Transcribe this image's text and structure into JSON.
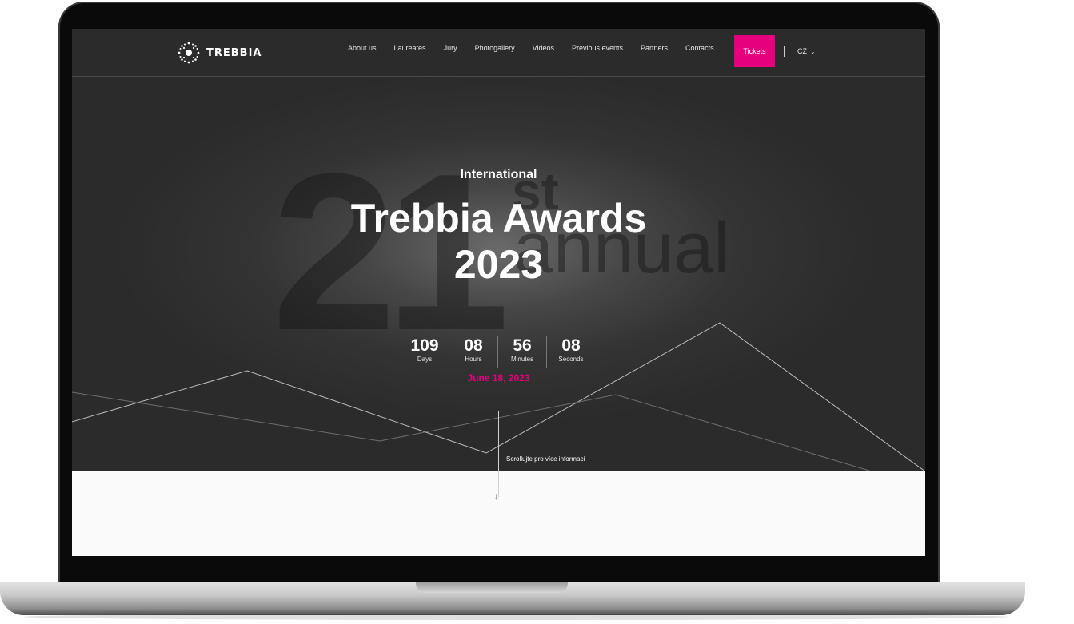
{
  "brand": {
    "name": "TREBBIA"
  },
  "nav": {
    "items": [
      "About us",
      "Laureates",
      "Jury",
      "Photogallery",
      "Videos",
      "Previous events",
      "Partners",
      "Contacts"
    ],
    "tickets": "Tickets",
    "language": "CZ"
  },
  "hero": {
    "backdrop_number": "21",
    "backdrop_suffix": "st",
    "backdrop_word": "annual",
    "kicker": "International",
    "title_line1": "Trebbia Awards",
    "title_line2": "2023",
    "countdown": [
      {
        "value": "109",
        "label": "Days"
      },
      {
        "value": "08",
        "label": "Hours"
      },
      {
        "value": "56",
        "label": "Minutes"
      },
      {
        "value": "08",
        "label": "Seconds"
      }
    ],
    "date": "June 18, 2023",
    "scroll_hint": "Scrollujte pro více informací"
  },
  "colors": {
    "accent": "#e6007e",
    "dark": "#2c2c2c"
  },
  "icons": {
    "logo": "starburst-logo-icon",
    "language_toggle": "chevron-down-icon",
    "scroll": "arrow-down-icon"
  }
}
